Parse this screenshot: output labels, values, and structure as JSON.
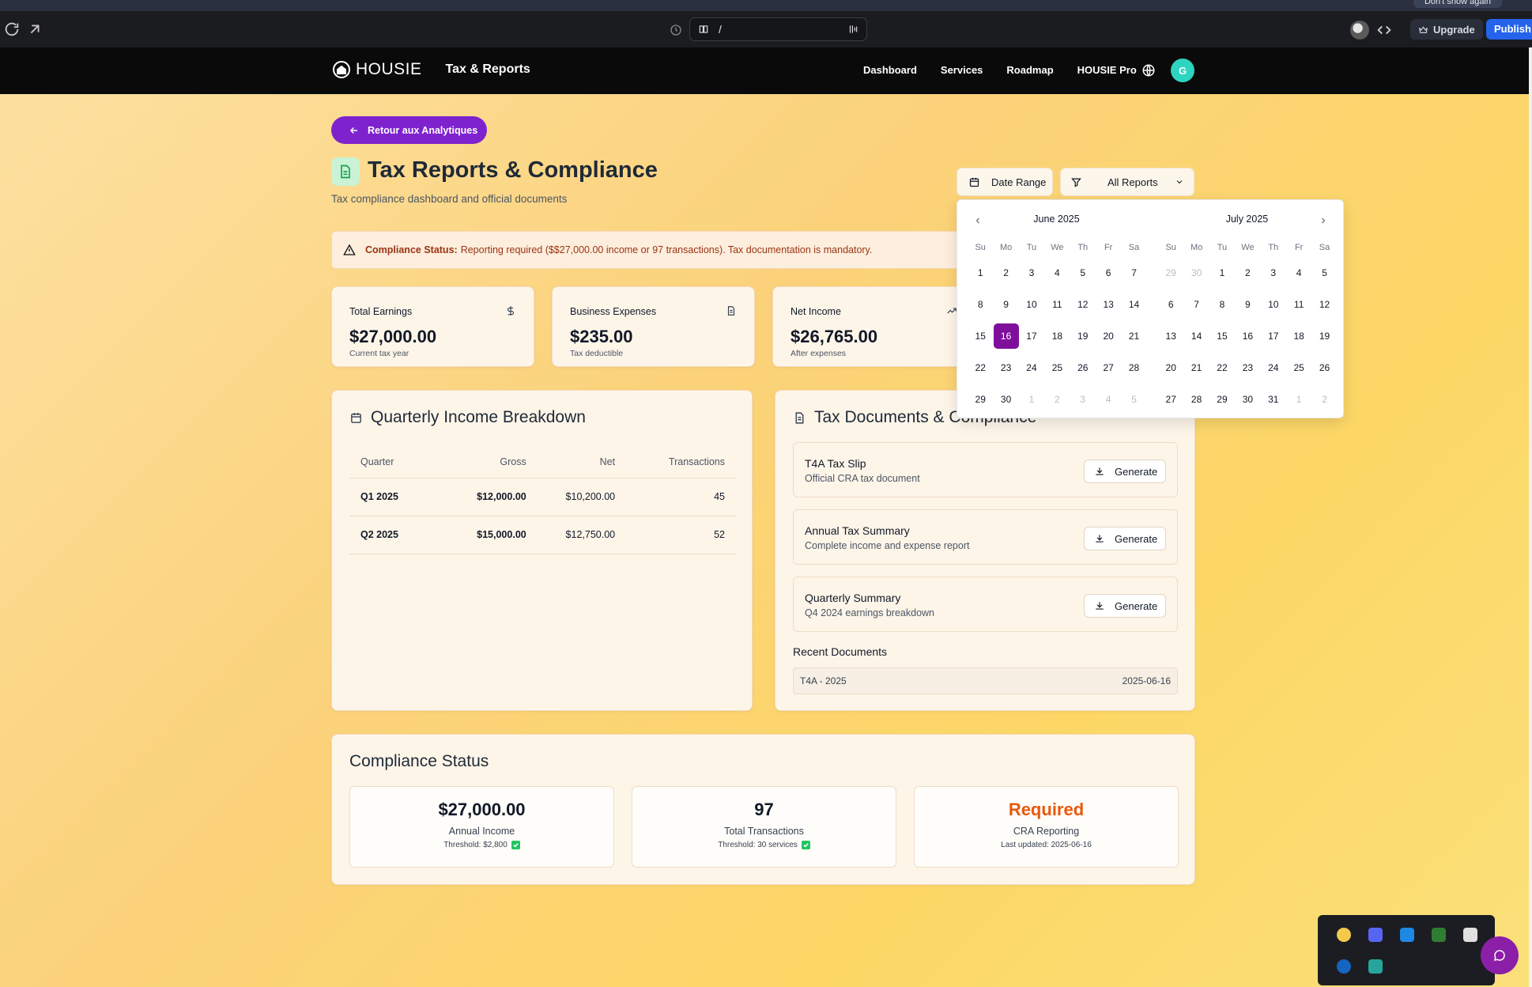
{
  "chrome": {
    "top_notice_button": "Don't show again",
    "url_path": "/",
    "upgrade_label": "Upgrade",
    "publish_label": "Publish"
  },
  "nav": {
    "brand": "HOUSIE",
    "section_title": "Tax & Reports",
    "links": [
      "Dashboard",
      "Services",
      "Roadmap",
      "HOUSIE Pro"
    ],
    "avatar_initial": "G"
  },
  "page": {
    "back_button": "Retour aux Analytiques",
    "title": "Tax Reports & Compliance",
    "subtitle": "Tax compliance dashboard and official documents",
    "date_range_label": "Date Range",
    "reports_filter_label": "All Reports"
  },
  "alert": {
    "label": "Compliance Status:",
    "message": "Reporting required ($$27,000.00 income or 97 transactions). Tax documentation is mandatory."
  },
  "stats": [
    {
      "label": "Total Earnings",
      "value": "$27,000.00",
      "sub": "Current tax year",
      "icon": "dollar-icon"
    },
    {
      "label": "Business Expenses",
      "value": "$235.00",
      "sub": "Tax deductible",
      "icon": "receipt-icon"
    },
    {
      "label": "Net Income",
      "value": "$26,765.00",
      "sub": "After expenses",
      "icon": "trending-up-icon"
    }
  ],
  "quarterly": {
    "title": "Quarterly Income Breakdown",
    "columns": [
      "Quarter",
      "Gross",
      "Net",
      "Transactions"
    ],
    "rows": [
      [
        "Q1 2025",
        "$12,000.00",
        "$10,200.00",
        "45"
      ],
      [
        "Q2 2025",
        "$15,000.00",
        "$12,750.00",
        "52"
      ]
    ]
  },
  "documents": {
    "title": "Tax Documents & Compliance",
    "generate_label": "Generate",
    "items": [
      {
        "name": "T4A Tax Slip",
        "desc": "Official CRA tax document"
      },
      {
        "name": "Annual Tax Summary",
        "desc": "Complete income and expense report"
      },
      {
        "name": "Quarterly Summary",
        "desc": "Q4 2024 earnings breakdown"
      }
    ],
    "recent_title": "Recent Documents",
    "recent": [
      {
        "name": "T4A - 2025",
        "date": "2025-06-16"
      }
    ]
  },
  "compliance": {
    "title": "Compliance Status",
    "boxes": [
      {
        "value": "$27,000.00",
        "label": "Annual Income",
        "note": "Threshold: $2,800",
        "checked": true
      },
      {
        "value": "97",
        "label": "Total Transactions",
        "note": "Threshold: 30 services",
        "checked": true
      },
      {
        "value": "Required",
        "label": "CRA Reporting",
        "note": "Last updated: 2025-06-16",
        "checked": false
      }
    ]
  },
  "calendar": {
    "weekdays": [
      "Su",
      "Mo",
      "Tu",
      "We",
      "Th",
      "Fr",
      "Sa"
    ],
    "selected_day": 16,
    "months": [
      {
        "title": "June 2025",
        "days": [
          "1",
          "2",
          "3",
          "4",
          "5",
          "6",
          "7",
          "8",
          "9",
          "10",
          "11",
          "12",
          "13",
          "14",
          "15",
          "16",
          "17",
          "18",
          "19",
          "20",
          "21",
          "22",
          "23",
          "24",
          "25",
          "26",
          "27",
          "28",
          "29",
          "30",
          "1",
          "2",
          "3",
          "4",
          "5"
        ],
        "outside_from": 30
      },
      {
        "title": "July 2025",
        "days": [
          "29",
          "30",
          "1",
          "2",
          "3",
          "4",
          "5",
          "6",
          "7",
          "8",
          "9",
          "10",
          "11",
          "12",
          "13",
          "14",
          "15",
          "16",
          "17",
          "18",
          "19",
          "20",
          "21",
          "22",
          "23",
          "24",
          "25",
          "26",
          "27",
          "28",
          "29",
          "30",
          "31",
          "1",
          "2"
        ],
        "outside_before": 2,
        "outside_from": 33
      }
    ]
  },
  "colors": {
    "accent_purple": "#7e22ce",
    "selected_day": "#7e0f9b",
    "required_orange": "#ea580c",
    "publish_blue": "#2563eb"
  }
}
